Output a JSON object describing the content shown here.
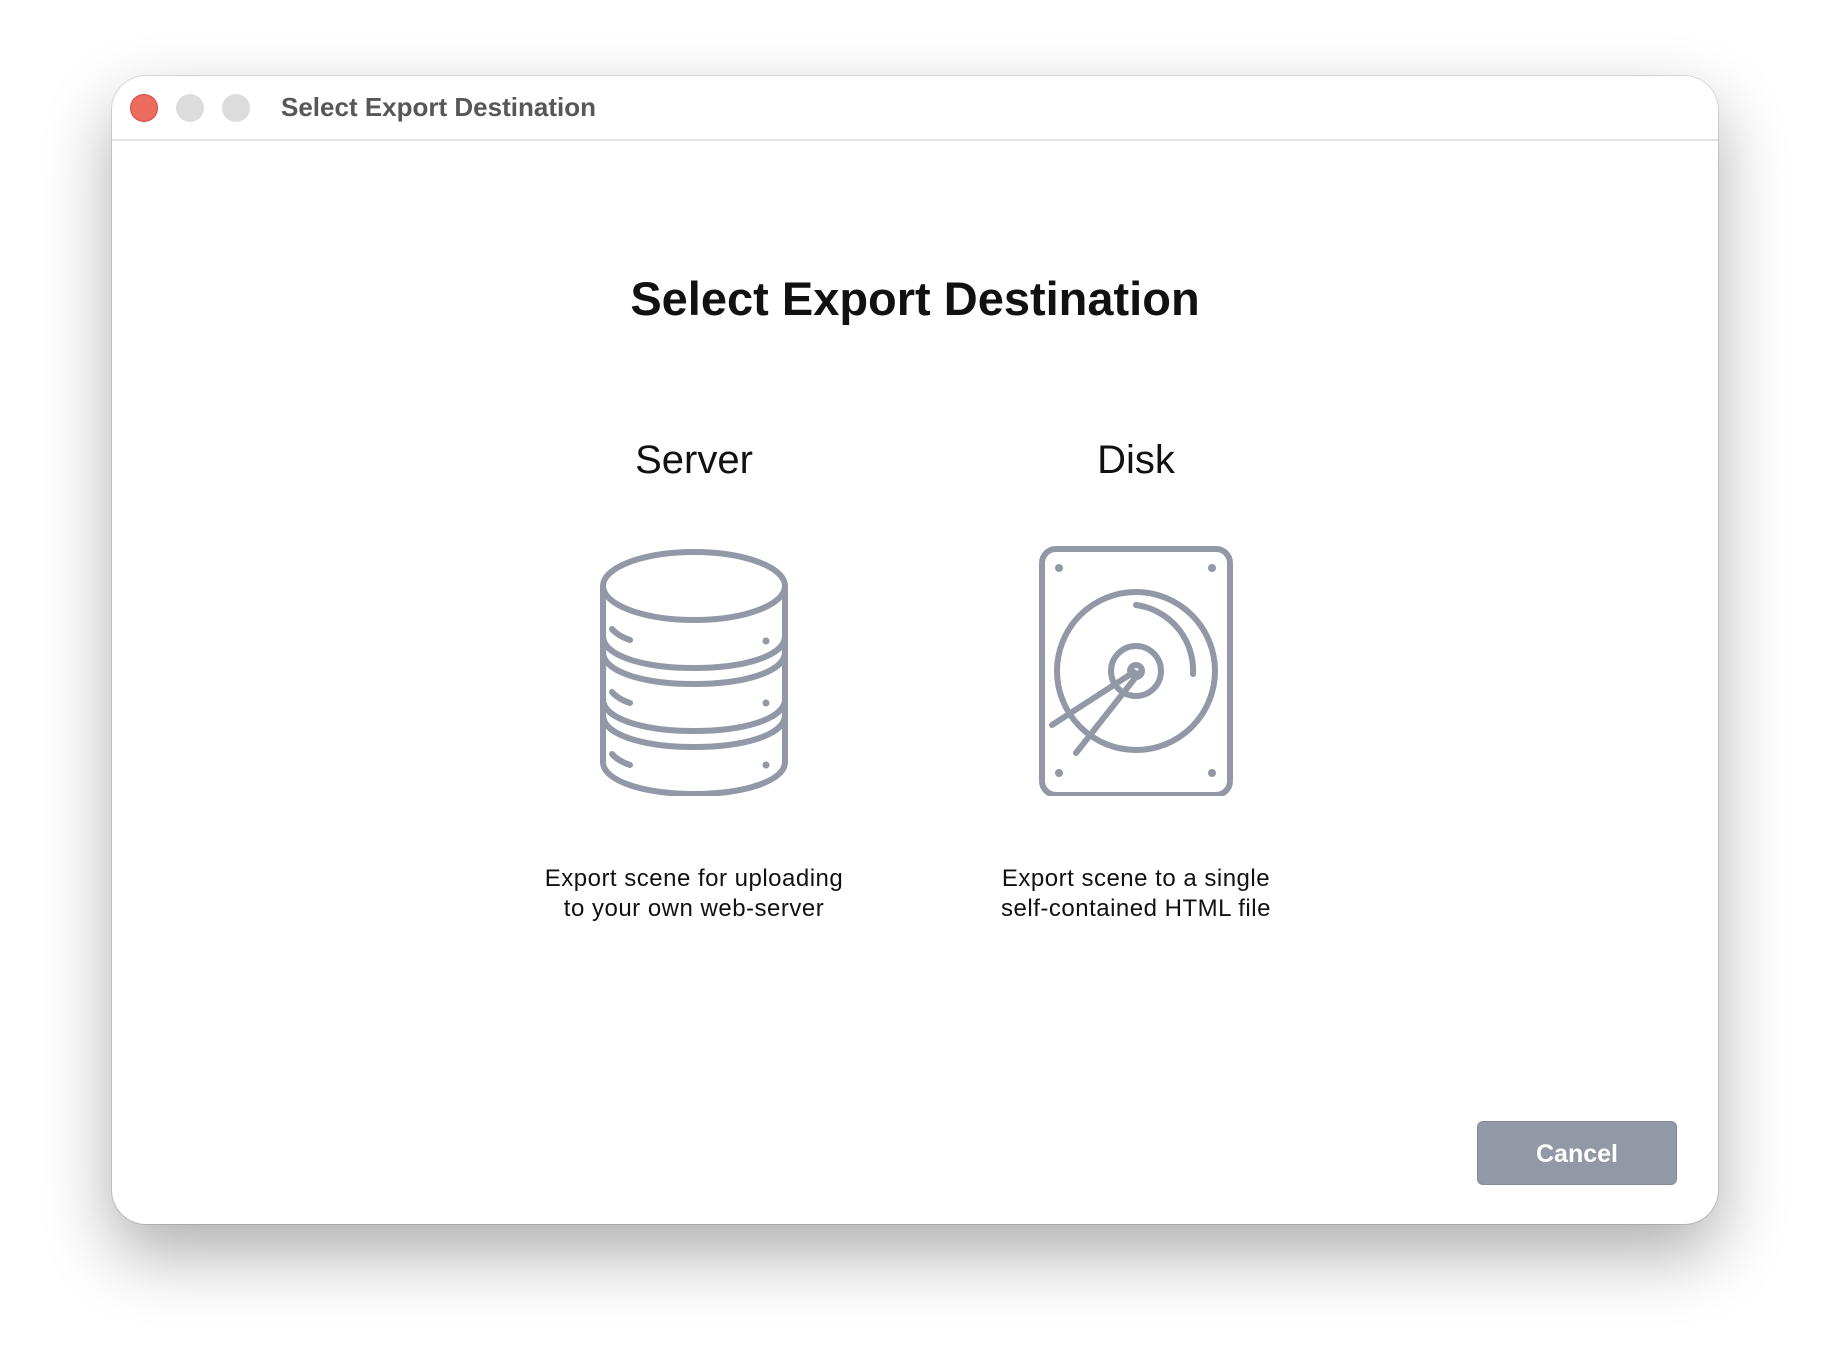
{
  "window": {
    "title": "Select Export Destination",
    "controls": [
      "close",
      "minimize",
      "maximize"
    ]
  },
  "dialog": {
    "heading": "Select Export Destination",
    "options": [
      {
        "label": "Server",
        "icon": "database-icon",
        "description": "Export scene for uploading to your own web-server"
      },
      {
        "label": "Disk",
        "icon": "hard-drive-icon",
        "description": "Export scene to a single self-contained HTML file"
      }
    ],
    "cancel_label": "Cancel"
  },
  "colors": {
    "icon_stroke": "#9398a6",
    "button_bg": "#9398a6",
    "close_button": "#ed6a5e"
  }
}
